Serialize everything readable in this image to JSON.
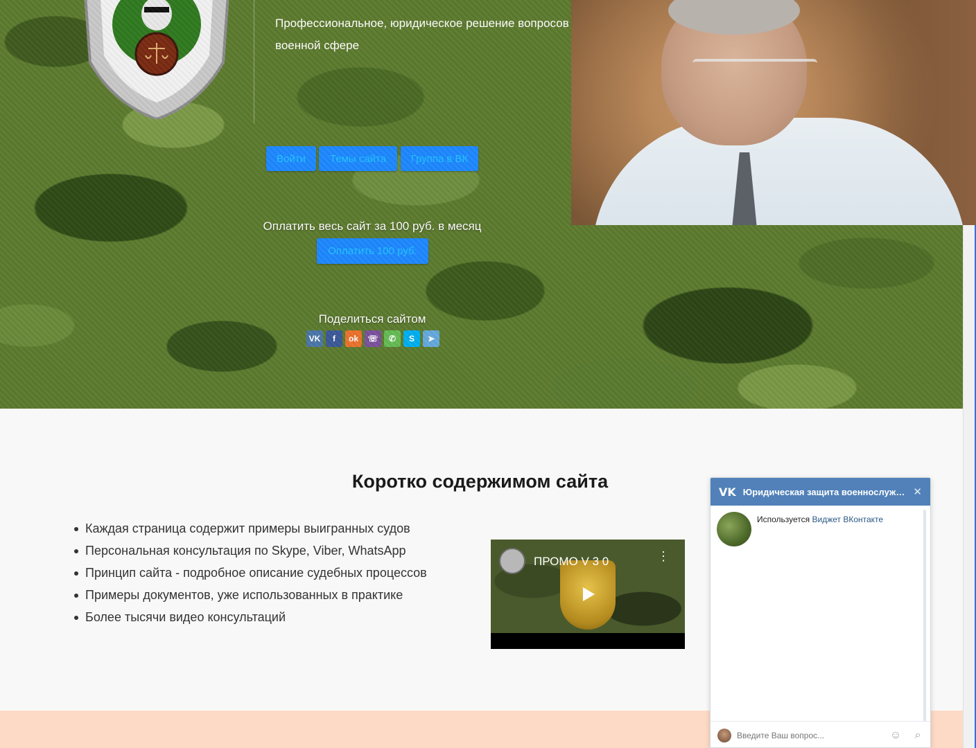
{
  "hero": {
    "tagline": "Профессиональное, юридическое решение вопросов в военной сфере",
    "nav": {
      "login": "Войти",
      "themes": "Темы сайта",
      "vk_group": "Группа в ВК"
    },
    "pay_text": "Оплатить весь сайт за 100 руб. в месяц",
    "pay_button": "Оплатить 100 руб.",
    "share_label": "Поделиться сайтом",
    "share_icons": [
      "vk-icon",
      "facebook-icon",
      "odnoklassniki-icon",
      "viber-icon",
      "whatsapp-icon",
      "skype-icon",
      "telegram-icon"
    ]
  },
  "content": {
    "title": "Коротко содержимом сайта",
    "features": [
      "Каждая страница содержит примеры выигранных судов",
      "Персональная консультация по Skype, Viber, WhatsApp",
      "Принцип сайта - подробное описание судебных процессов",
      "Примеры документов, уже использованных в практике",
      "Более тысячи видео консультаций"
    ]
  },
  "video": {
    "title": "ПРОМО V 3 0"
  },
  "vk_widget": {
    "title": "Юридическая защита военнослужа...",
    "used_prefix": "Используется ",
    "used_link": "Виджет ВКонтакте",
    "input_placeholder": "Введите Ваш вопрос..."
  },
  "colors": {
    "button_bg": "#1e88ff",
    "button_text": "#1fc3ff",
    "vk_header": "#5181b8",
    "footer_band": "#fddac5"
  }
}
